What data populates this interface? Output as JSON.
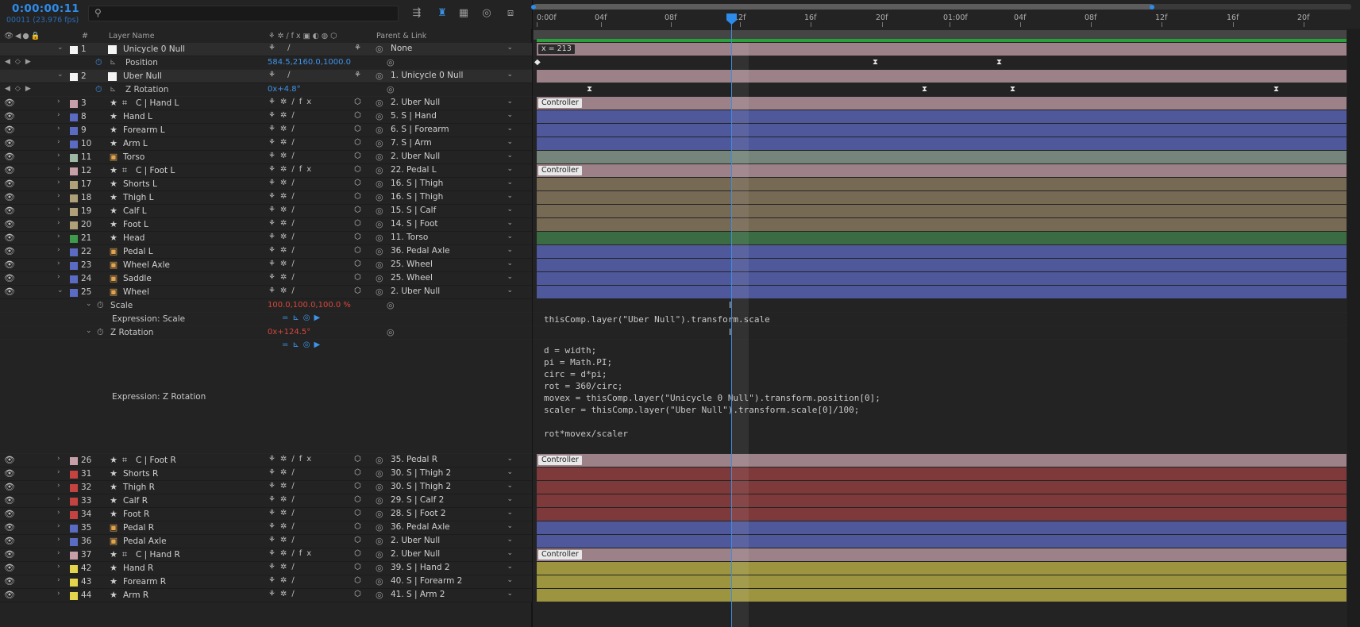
{
  "header": {
    "timecode": "0:00:00:11",
    "frame_info": "00011 (23.976 fps)",
    "search_placeholder": "",
    "columns": {
      "av": "",
      "label": "",
      "num": "#",
      "name": "Layer Name",
      "switches": "",
      "parent": "Parent & Link"
    }
  },
  "ruler": {
    "ticks": [
      "0:00f",
      "04f",
      "08f",
      "12f",
      "16f",
      "20f",
      "01:00f",
      "04f",
      "08f",
      "12f",
      "16f",
      "20f"
    ]
  },
  "colors": {
    "pink": "#c69fa8",
    "blue": "#5b6ac2",
    "sage": "#9db8a3",
    "tan": "#b0a07a",
    "green": "#3f9a4b",
    "red": "#c4423f",
    "yellow": "#e3d44c",
    "white": "#f4f4f4",
    "bar_pink": "#9d8188",
    "bar_blue": "#4f589a",
    "bar_sage": "#75857b",
    "bar_tan": "#776a55",
    "bar_green": "#3b6b42",
    "bar_red": "#7e393a",
    "bar_yellow": "#9d9440"
  },
  "layers": [
    {
      "num": "1",
      "name": "Unicycle 0 Null",
      "parent": "None",
      "color": "white",
      "type": "null",
      "expanded": true,
      "label": "x = 213"
    },
    {
      "num": "2",
      "name": "Uber Null",
      "parent": "1. Unicycle 0 Null",
      "color": "white",
      "type": "null",
      "expanded": true,
      "label": ""
    },
    {
      "num": "3",
      "name": "C | Hand L",
      "parent": "2. Uber Null",
      "color": "pink",
      "type": "shape",
      "label": "Controller"
    },
    {
      "num": "8",
      "name": "Hand L",
      "parent": "5. S | Hand",
      "color": "blue",
      "type": "puppet"
    },
    {
      "num": "9",
      "name": "Forearm L",
      "parent": "6. S | Forearm",
      "color": "blue",
      "type": "puppet"
    },
    {
      "num": "10",
      "name": "Arm L",
      "parent": "7. S | Arm",
      "color": "blue",
      "type": "puppet"
    },
    {
      "num": "11",
      "name": "Torso",
      "parent": "2. Uber Null",
      "color": "sage",
      "type": "image"
    },
    {
      "num": "12",
      "name": "C | Foot L",
      "parent": "22. Pedal L",
      "color": "pink",
      "type": "shape",
      "label": "Controller"
    },
    {
      "num": "17",
      "name": "Shorts L",
      "parent": "16. S | Thigh",
      "color": "tan",
      "type": "puppet"
    },
    {
      "num": "18",
      "name": "Thigh L",
      "parent": "16. S | Thigh",
      "color": "tan",
      "type": "puppet"
    },
    {
      "num": "19",
      "name": "Calf L",
      "parent": "15. S | Calf",
      "color": "tan",
      "type": "puppet"
    },
    {
      "num": "20",
      "name": "Foot L",
      "parent": "14. S | Foot",
      "color": "tan",
      "type": "puppet"
    },
    {
      "num": "21",
      "name": "Head",
      "parent": "11. Torso",
      "color": "green",
      "type": "puppet"
    },
    {
      "num": "22",
      "name": "Pedal L",
      "parent": "36. Pedal Axle",
      "color": "blue",
      "type": "image"
    },
    {
      "num": "23",
      "name": "Wheel Axle",
      "parent": "25. Wheel",
      "color": "blue",
      "type": "image"
    },
    {
      "num": "24",
      "name": "Saddle",
      "parent": "25. Wheel",
      "color": "blue",
      "type": "image"
    },
    {
      "num": "25",
      "name": "Wheel",
      "parent": "2. Uber Null",
      "color": "blue",
      "type": "image",
      "expanded": true
    },
    {
      "num": "26",
      "name": "C | Foot R",
      "parent": "35. Pedal R",
      "color": "pink",
      "type": "shape",
      "label": "Controller"
    },
    {
      "num": "31",
      "name": "Shorts R",
      "parent": "30. S | Thigh 2",
      "color": "red",
      "type": "puppet"
    },
    {
      "num": "32",
      "name": "Thigh R",
      "parent": "30. S | Thigh 2",
      "color": "red",
      "type": "puppet"
    },
    {
      "num": "33",
      "name": "Calf R",
      "parent": "29. S | Calf 2",
      "color": "red",
      "type": "puppet"
    },
    {
      "num": "34",
      "name": "Foot R",
      "parent": "28. S | Foot 2",
      "color": "red",
      "type": "puppet"
    },
    {
      "num": "35",
      "name": "Pedal R",
      "parent": "36. Pedal Axle",
      "color": "blue",
      "type": "image"
    },
    {
      "num": "36",
      "name": "Pedal Axle",
      "parent": "2. Uber Null",
      "color": "blue",
      "type": "image"
    },
    {
      "num": "37",
      "name": "C | Hand R",
      "parent": "2. Uber Null",
      "color": "pink",
      "type": "shape",
      "label": "Controller"
    },
    {
      "num": "42",
      "name": "Hand R",
      "parent": "39. S | Hand 2",
      "color": "yellow",
      "type": "puppet"
    },
    {
      "num": "43",
      "name": "Forearm R",
      "parent": "40. S | Forearm 2",
      "color": "yellow",
      "type": "puppet"
    },
    {
      "num": "44",
      "name": "Arm R",
      "parent": "41. S | Arm 2",
      "color": "yellow",
      "type": "puppet"
    }
  ],
  "props": {
    "position": {
      "name": "Position",
      "value": "584.5,2160.0,1000.0"
    },
    "zrot_uber": {
      "name": "Z Rotation",
      "value": "0x+4.8°"
    },
    "scale": {
      "name": "Scale",
      "value": "100.0,100.0,100.0 %"
    },
    "expr_scale": {
      "name": "Expression: Scale",
      "code": "thisComp.layer(\"Uber Null\").transform.scale"
    },
    "zrot_wheel": {
      "name": "Z Rotation",
      "value": "0x+124.5°"
    },
    "expr_zrot": {
      "name": "Expression: Z Rotation",
      "code": "d = width;\npi = Math.PI;\ncirc = d*pi;\nrot = 360/circ;\nmovex = thisComp.layer(\"Unicycle 0 Null\").transform.position[0];\nscaler = thisComp.layer(\"Uber Null\").transform.scale[0]/100;\n\nrot*movex/scaler"
    }
  }
}
